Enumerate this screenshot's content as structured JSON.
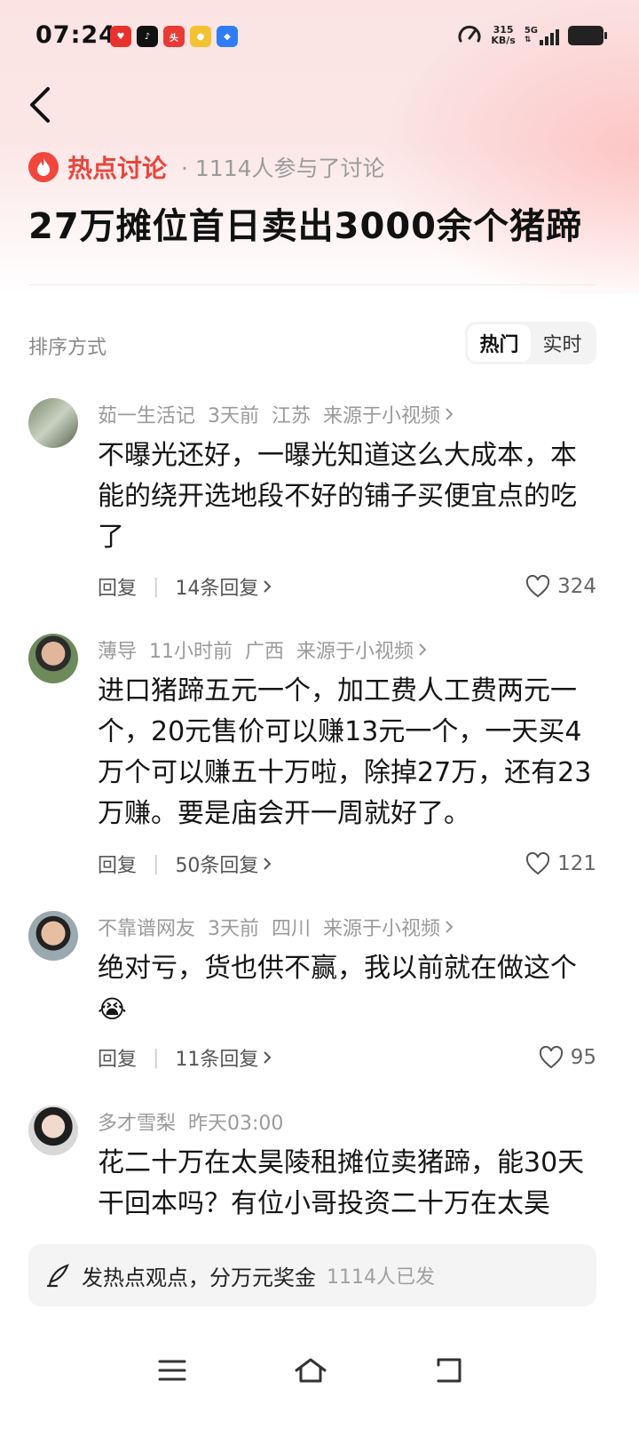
{
  "status": {
    "time": "07:24",
    "speed_value": "315",
    "speed_unit": "KB/s",
    "network": "5G"
  },
  "topic": {
    "badge": "热点讨论",
    "participants": "· 1114人参与了讨论",
    "title": "27万摊位首日卖出3000余个猪蹄"
  },
  "sort": {
    "label": "排序方式",
    "options": [
      "热门",
      "实时"
    ],
    "selected": "热门"
  },
  "comments": [
    {
      "author": "茹一生活记",
      "time": "3天前",
      "location": "江苏",
      "source": "来源于小视频",
      "text": "不曝光还好，一曝光知道这么大成本，本能的绕开选地段不好的铺子买便宜点的吃了",
      "reply": "回复",
      "reply_count": "14条回复",
      "likes": "324"
    },
    {
      "author": "薄导",
      "time": "11小时前",
      "location": "广西",
      "source": "来源于小视频",
      "text": "进口猪蹄五元一个，加工费人工费两元一个，20元售价可以赚13元一个，一天买4万个可以赚五十万啦，除掉27万，还有23万赚。要是庙会开一周就好了。",
      "reply": "回复",
      "reply_count": "50条回复",
      "likes": "121"
    },
    {
      "author": "不靠谱网友",
      "time": "3天前",
      "location": "四川",
      "source": "来源于小视频",
      "text": "绝对亏，货也供不赢，我以前就在做这个",
      "emoji": "😭",
      "reply": "回复",
      "reply_count": "11条回复",
      "likes": "95"
    },
    {
      "author": "多才雪梨",
      "time": "昨天03:00",
      "text": "花二十万在太昊陵租摊位卖猪蹄，能30天干回本吗？有位小哥投资二十万在太昊"
    }
  ],
  "post_bar": {
    "text": "发热点观点，分万元奖金",
    "count": "1114人已发"
  },
  "colors": {
    "accent": "#e8463c",
    "muted": "#9a9a9a"
  }
}
